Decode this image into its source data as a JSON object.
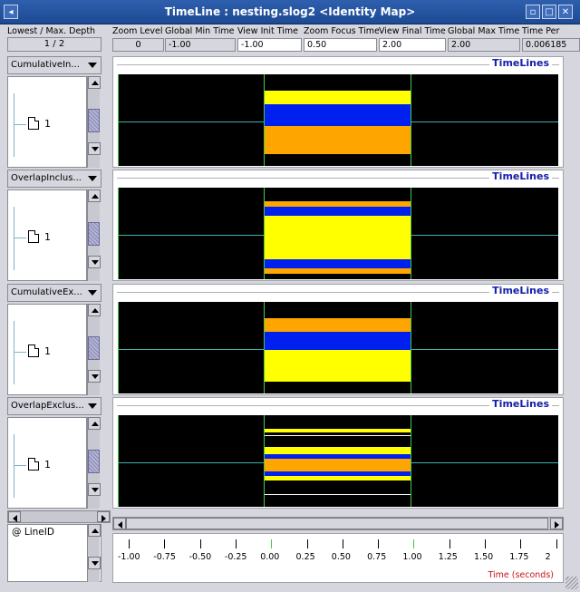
{
  "window": {
    "title": "TimeLine : nesting.slog2  <Identity Map>"
  },
  "header": {
    "labels": [
      "Lowest / Max. Depth",
      "Zoom Level",
      "Global Min Time",
      "View  Init Time",
      "Zoom Focus Time",
      "View Final Time",
      "Global Max Time",
      "Time Per"
    ],
    "depth_value": "1 / 2",
    "zoom_level": "0",
    "global_min_time": "-1.00",
    "view_init_time": "-1.00",
    "zoom_focus_time": "0.50",
    "view_final_time": "2.00",
    "global_max_time": "2.00",
    "time_per_pixel": "0.006185"
  },
  "panels": [
    {
      "combo_label": "CumulativeIn...",
      "tree_item": "1",
      "label": "TimeLines"
    },
    {
      "combo_label": "OverlapInclus...",
      "tree_item": "1",
      "label": "TimeLines"
    },
    {
      "combo_label": "CumulativeEx...",
      "tree_item": "1",
      "label": "TimeLines"
    },
    {
      "combo_label": "OverlapExclus...",
      "tree_item": "1",
      "label": "TimeLines"
    }
  ],
  "legend_label": "@ LineID",
  "ruler": {
    "ticks": [
      "-1.00",
      "-0.75",
      "-0.50",
      "-0.25",
      "0.00",
      "0.25",
      "0.50",
      "0.75",
      "1.00",
      "1.25",
      "1.50",
      "1.75",
      "2"
    ],
    "axis_label": "Time (seconds)"
  },
  "colors": {
    "yellow": "#ffff00",
    "blue": "#0020f0",
    "orange": "#ffa500",
    "grid": "#3cb4b4",
    "marker": "#46c846",
    "label": "#1420a8"
  }
}
